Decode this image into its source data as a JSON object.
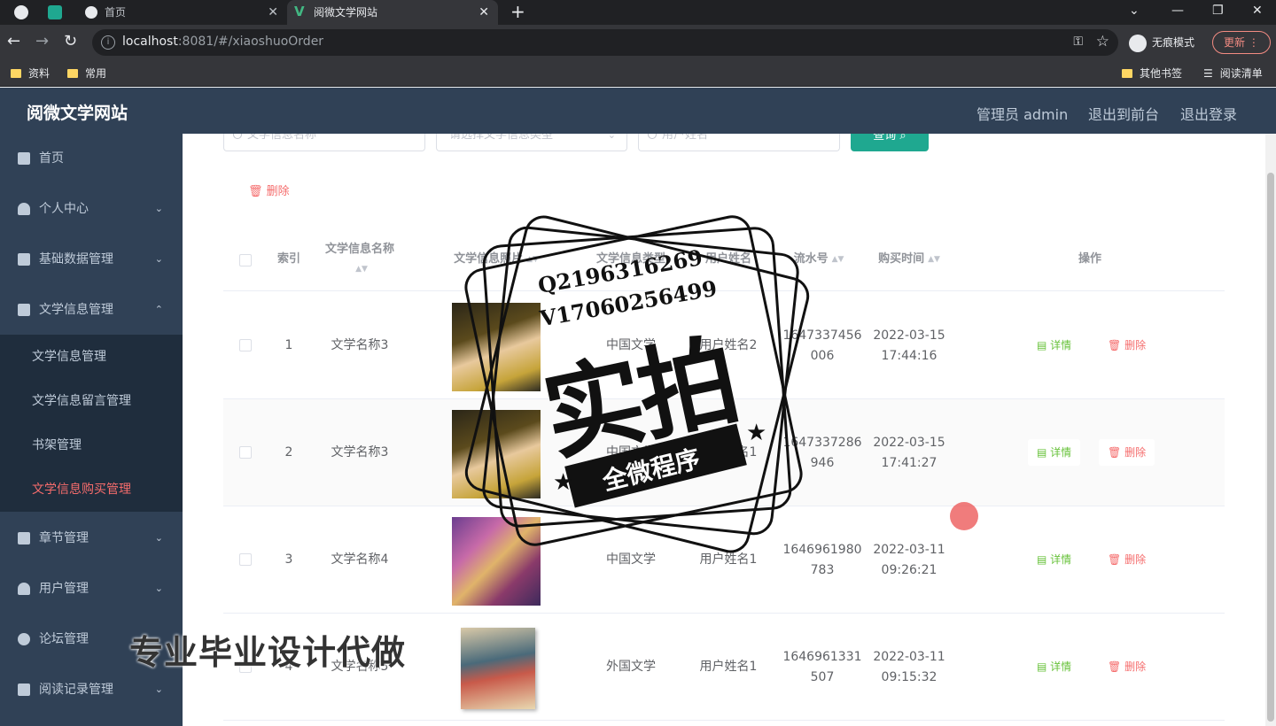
{
  "browser": {
    "tabs": [
      {
        "label": "首页"
      },
      {
        "label": "阅微文学网站"
      }
    ],
    "url_host": "localhost",
    "url_rest": ":8081/#/xiaoshuoOrder",
    "profile_label": "无痕模式",
    "update_label": "更新",
    "bookmarks": [
      "资料",
      "常用"
    ],
    "bookmarks_right": [
      "其他书签",
      "阅读清单"
    ]
  },
  "header": {
    "brand": "阅微文学网站",
    "admin": "管理员 admin",
    "to_front": "退出到前台",
    "logout": "退出登录"
  },
  "sidebar": {
    "items": [
      {
        "label": "首页",
        "icon": "home-icon"
      },
      {
        "label": "个人中心",
        "icon": "user-icon"
      },
      {
        "label": "基础数据管理",
        "icon": "clipboard-icon"
      },
      {
        "label": "文学信息管理",
        "icon": "chat-icon"
      },
      {
        "label": "章节管理",
        "icon": "printer-icon"
      },
      {
        "label": "用户管理",
        "icon": "user-icon"
      },
      {
        "label": "论坛管理",
        "icon": "compass-icon"
      },
      {
        "label": "阅读记录管理",
        "icon": "printer-icon"
      }
    ],
    "subitems": [
      "文学信息管理",
      "文学信息留言管理",
      "书架管理",
      "文学信息购买管理"
    ]
  },
  "search": {
    "name_placeholder": "文学信息名称",
    "type_placeholder": "请选择文学信息类型",
    "user_placeholder": "用户姓名",
    "query_label": "查询"
  },
  "toolbar": {
    "delete_label": "删除"
  },
  "table": {
    "headers": {
      "index": "索引",
      "name": "文学信息名称",
      "photo": "文学信息照片",
      "type": "文学信息类型",
      "user": "用户姓名",
      "serial": "流水号",
      "time": "购买时间",
      "ops": "操作"
    },
    "rows": [
      {
        "index": "1",
        "name": "文学名称3",
        "type": "中国文学",
        "user": "用户姓名2",
        "serial": "1647337456006",
        "date": "2022-03-15",
        "time": "17:44:16"
      },
      {
        "index": "2",
        "name": "文学名称3",
        "type": "中国文学",
        "user": "用户姓名1",
        "serial": "1647337286946",
        "date": "2022-03-15",
        "time": "17:41:27"
      },
      {
        "index": "3",
        "name": "文学名称4",
        "type": "中国文学",
        "user": "用户姓名1",
        "serial": "1646961980783",
        "date": "2022-03-11",
        "time": "09:26:21"
      },
      {
        "index": "4",
        "name": "文学名称5",
        "type": "外国文学",
        "user": "用户姓名1",
        "serial": "1646961331507",
        "date": "2022-03-11",
        "time": "09:15:32"
      }
    ],
    "detail_label": "详情",
    "delete_label": "删除"
  },
  "watermark": {
    "q": "Q2196316269",
    "v": "V17060256499",
    "big": "实拍",
    "banner": "全微程序",
    "bottom": "专业毕业设计代做"
  }
}
